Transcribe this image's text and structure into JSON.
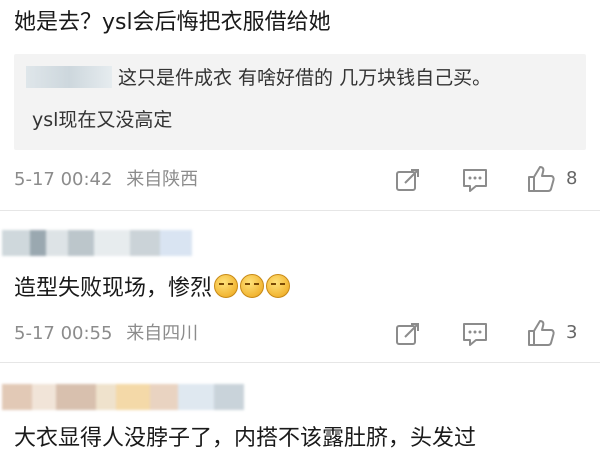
{
  "comments": [
    {
      "text": "她是去？ysl会后悔把衣服借给她",
      "quote": {
        "line1": "这只是件成衣 有啥好借的 几万块钱自己买。",
        "line2": "ysl现在又没高定"
      },
      "time": "5-17 00:42",
      "location": "来自陕西",
      "likes": "8"
    },
    {
      "text": "造型失败现场，惨烈",
      "emoji_count": 3,
      "time": "5-17 00:55",
      "location": "来自四川",
      "likes": "3"
    },
    {
      "text": "大衣显得人没脖子了，内搭不该露肚脐，头发过"
    }
  ],
  "icons": {
    "share": "share-icon",
    "comment": "comment-icon",
    "like": "thumbs-up-icon"
  },
  "colors": {
    "meta": "#8c8c8c",
    "quote_bg": "#f3f3f3",
    "divider": "#e6e6e6"
  }
}
